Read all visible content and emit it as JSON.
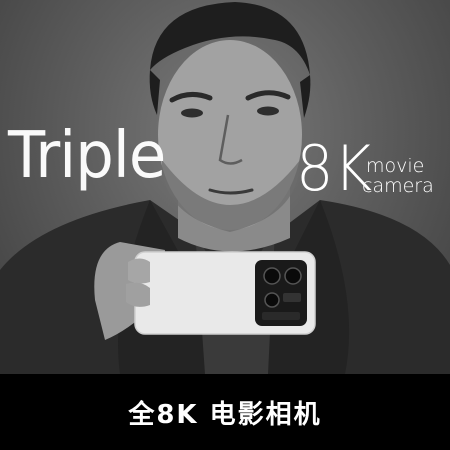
{
  "headline": {
    "word1": "Triple",
    "word2": "8K",
    "word3": "movie",
    "word4": "camera"
  },
  "footer": {
    "caption": "全8K 电影相机"
  },
  "colors": {
    "background": "#5e5e5e",
    "footer_bg": "#000000",
    "text": "#ffffff"
  }
}
